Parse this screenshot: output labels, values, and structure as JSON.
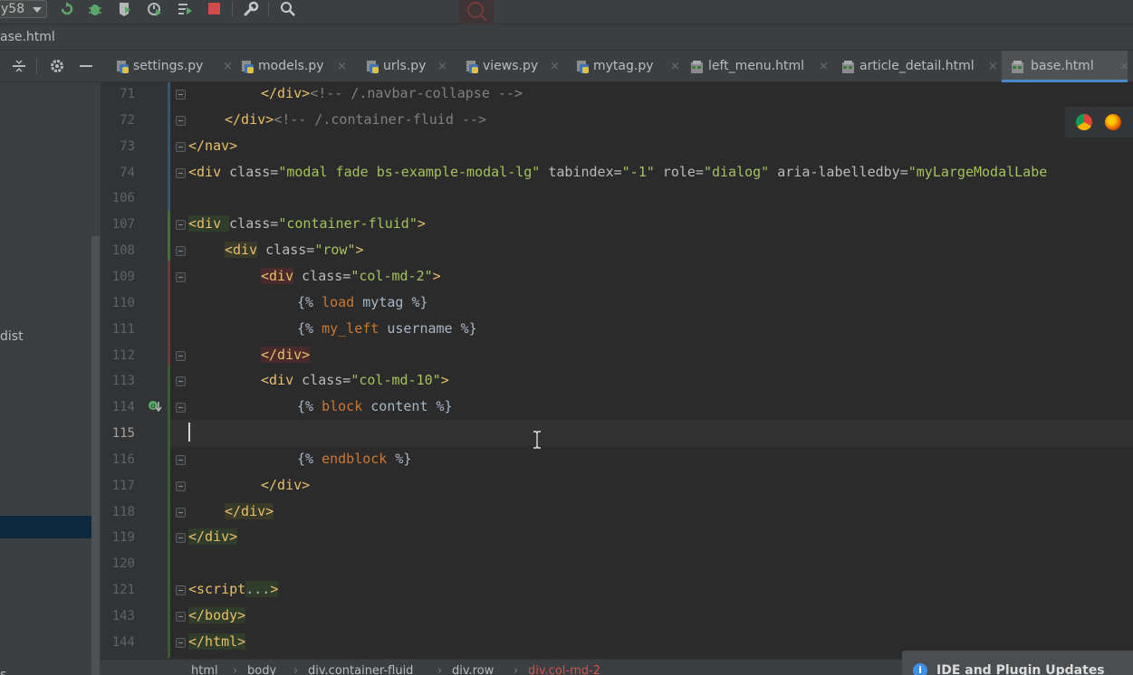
{
  "toolbar": {
    "run_config": "y58",
    "icons": [
      "rerun-icon",
      "debug-icon",
      "coverage-icon",
      "profile-icon",
      "run-list-icon",
      "stop-icon",
      "wrench-icon",
      "search-icon"
    ]
  },
  "path_bar": {
    "file": "ase.html"
  },
  "sidebar": {
    "items": [
      {
        "label": "dist"
      },
      {
        "label": ""
      },
      {
        "label": "s"
      }
    ]
  },
  "tabs": [
    {
      "label": "settings.py",
      "type": "python"
    },
    {
      "label": "models.py",
      "type": "python"
    },
    {
      "label": "urls.py",
      "type": "python"
    },
    {
      "label": "views.py",
      "type": "python"
    },
    {
      "label": "mytag.py",
      "type": "python"
    },
    {
      "label": "left_menu.html",
      "type": "html"
    },
    {
      "label": "article_detail.html",
      "type": "html"
    },
    {
      "label": "base.html",
      "type": "html",
      "active": true
    }
  ],
  "tab_close_glyph": "×",
  "editor": {
    "current_line": "115",
    "lines": [
      {
        "num": "71",
        "t": [
          "</div>",
          "<!-- /.navbar-collapse -->"
        ]
      },
      {
        "num": "72",
        "t": [
          "</div>",
          "<!-- /.container-fluid -->"
        ]
      },
      {
        "num": "73",
        "t": [
          "</nav>"
        ]
      },
      {
        "num": "74",
        "t": [
          "<div ",
          "class=",
          "\"modal fade bs-example-modal-lg\"",
          " tabindex=",
          "\"-1\"",
          " role=",
          "\"dialog\"",
          " aria-labelledby=",
          "\"myLargeModalLabe"
        ]
      },
      {
        "num": "106",
        "t": []
      },
      {
        "num": "107",
        "t": [
          "<div ",
          "class=",
          "\"container-fluid\"",
          ">"
        ]
      },
      {
        "num": "108",
        "t": [
          "<div",
          " class=",
          "\"row\"",
          ">"
        ]
      },
      {
        "num": "109",
        "t": [
          "<div",
          " class=",
          "\"col-md-2\"",
          ">"
        ]
      },
      {
        "num": "110",
        "t": [
          "{% ",
          "load",
          " mytag ",
          "%}"
        ]
      },
      {
        "num": "111",
        "t": [
          "{% ",
          "my_left",
          " username ",
          "%}"
        ]
      },
      {
        "num": "112",
        "t": [
          "</div>"
        ]
      },
      {
        "num": "113",
        "t": [
          "<div ",
          "class=",
          "\"col-md-10\"",
          ">"
        ]
      },
      {
        "num": "114",
        "t": [
          "{% ",
          "block",
          " content ",
          "%}"
        ]
      },
      {
        "num": "115",
        "t": []
      },
      {
        "num": "116",
        "t": [
          "{% ",
          "endblock",
          " %}"
        ]
      },
      {
        "num": "117",
        "t": [
          "</div>"
        ]
      },
      {
        "num": "118",
        "t": [
          "</div>"
        ]
      },
      {
        "num": "119",
        "t": [
          "</div>"
        ]
      },
      {
        "num": "120",
        "t": []
      },
      {
        "num": "121",
        "t": [
          "<script",
          "...",
          ">"
        ]
      },
      {
        "num": "143",
        "t": [
          "</body>"
        ]
      },
      {
        "num": "144",
        "t": [
          "</html>"
        ]
      }
    ]
  },
  "breadcrumb": [
    "html",
    "body",
    "div.container-fluid",
    "div.row",
    "div.col-md-2"
  ],
  "breadcrumb_sep": "›",
  "notification": {
    "text": "IDE and Plugin Updates",
    "icon": "info-icon",
    "icon_glyph": "i"
  },
  "colors": {
    "tag": "#e8bf6a",
    "attr": "#bababa",
    "string": "#a5c25c",
    "comment": "#808080",
    "accent": "#4a88c7"
  }
}
